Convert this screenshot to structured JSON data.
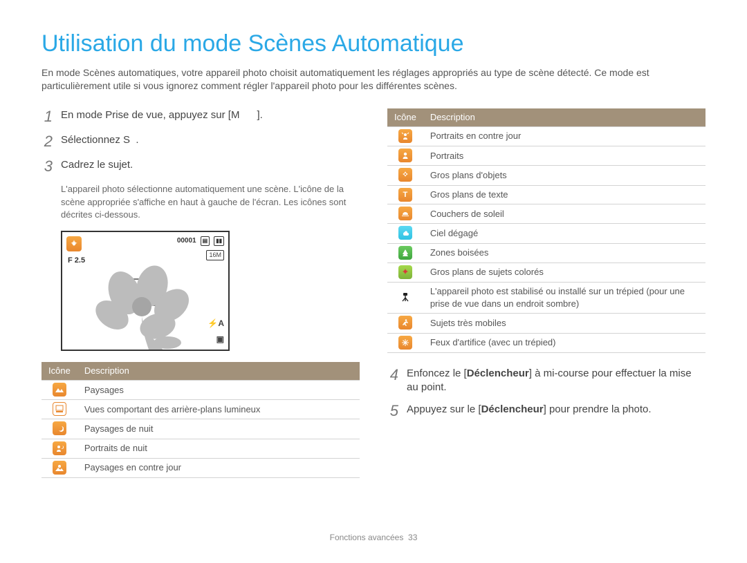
{
  "page_title": "Utilisation du mode Scènes Automatique",
  "intro_text": "En mode Scènes automatiques, votre appareil photo choisit automatiquement les réglages appropriés au type de scène détecté. Ce mode est particulièrement utile si vous ignorez comment régler l'appareil photo pour les différentes scènes.",
  "steps": {
    "s1": {
      "num": "1",
      "text": "En mode Prise de vue, appuyez sur [M      ]."
    },
    "s2": {
      "num": "2",
      "text": "Sélectionnez S  ."
    },
    "s3": {
      "num": "3",
      "text": "Cadrez le sujet.",
      "note": "L'appareil photo sélectionne automatiquement une scène. L'icône de la scène appropriée s'affiche en haut à gauche de l'écran. Les icônes sont décrites ci-dessous."
    },
    "s4": {
      "num": "4",
      "text_before": "Enfoncez le [",
      "bold": "Déclencheur",
      "text_after": "] à mi-course pour effectuer la mise au point."
    },
    "s5": {
      "num": "5",
      "text_before": "Appuyez sur le [",
      "bold": "Déclencheur",
      "text_after": "] pour prendre la photo."
    }
  },
  "preview": {
    "aperture": "F 2.5",
    "counter": "00001",
    "res": "16M",
    "flash": "⚡A"
  },
  "table": {
    "head_icon": "Icône",
    "head_desc": "Description",
    "left_rows": [
      {
        "icon": "landscape-icon",
        "desc": "Paysages"
      },
      {
        "icon": "white-screen-icon",
        "desc": "Vues comportant des arrière-plans lumineux"
      },
      {
        "icon": "night-landscape-icon",
        "desc": "Paysages de nuit"
      },
      {
        "icon": "night-portrait-icon",
        "desc": "Portraits de nuit"
      },
      {
        "icon": "backlight-landscape-icon",
        "desc": "Paysages en contre jour"
      }
    ],
    "right_rows": [
      {
        "icon": "backlight-portrait-icon",
        "desc": "Portraits en contre jour"
      },
      {
        "icon": "portrait-icon",
        "desc": "Portraits"
      },
      {
        "icon": "macro-icon",
        "desc": "Gros plans d'objets"
      },
      {
        "icon": "macro-text-icon",
        "desc": "Gros plans de texte"
      },
      {
        "icon": "sunset-icon",
        "desc": "Couchers de soleil"
      },
      {
        "icon": "clear-sky-icon",
        "desc": "Ciel dégagé"
      },
      {
        "icon": "forest-icon",
        "desc": "Zones boisées"
      },
      {
        "icon": "macro-color-icon",
        "desc": "Gros plans de sujets colorés"
      },
      {
        "icon": "tripod-icon",
        "desc": "L'appareil photo est stabilisé ou installé sur un trépied (pour une prise de vue dans un endroit sombre)"
      },
      {
        "icon": "action-icon",
        "desc": "Sujets très mobiles"
      },
      {
        "icon": "firework-icon",
        "desc": "Feux d'artifice (avec un trépied)"
      }
    ]
  },
  "footer": {
    "section": "Fonctions avancées",
    "page_num": "33"
  }
}
